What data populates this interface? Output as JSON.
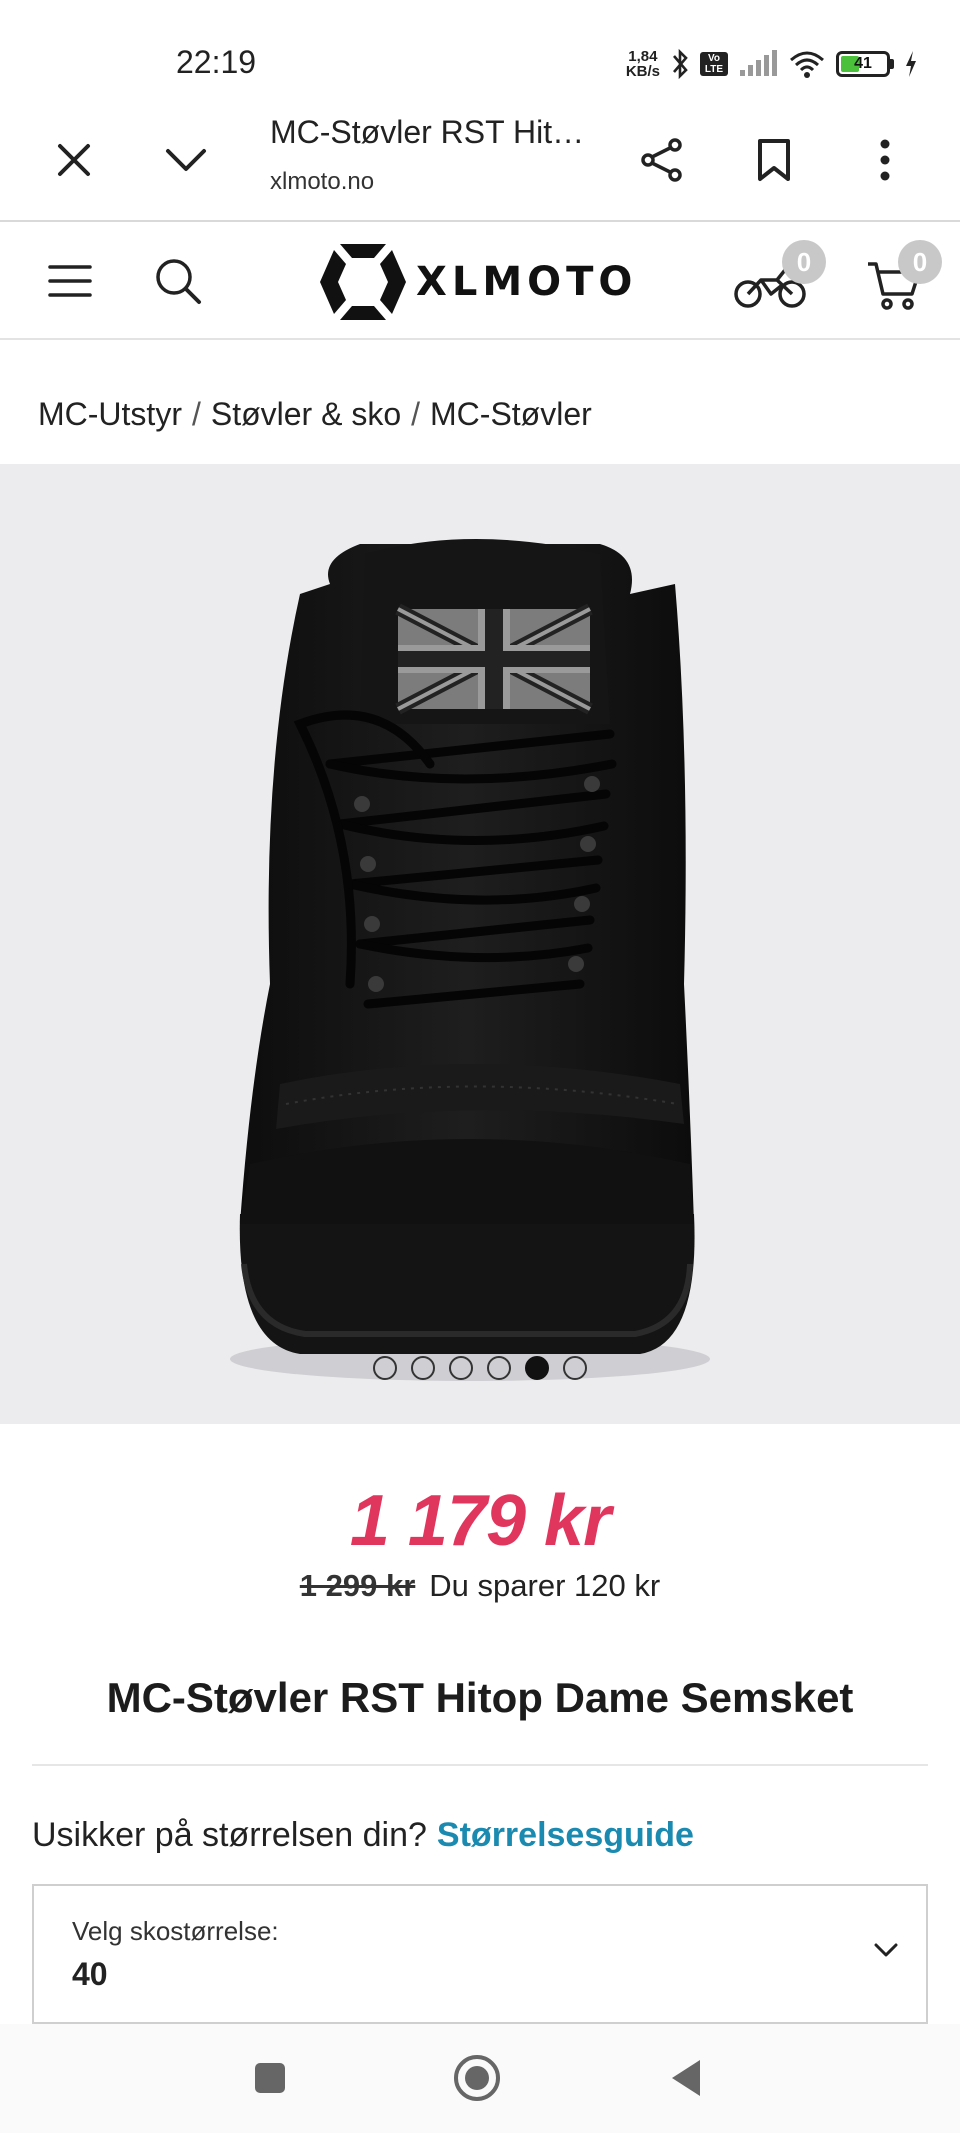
{
  "status_bar": {
    "time": "22:19",
    "net_speed_value": "1,84",
    "net_speed_unit": "KB/s",
    "volte": "Vo LTE",
    "battery_level": "41",
    "battery_fraction": 0.41,
    "battery_color": "#4bc03a"
  },
  "browser": {
    "tab_title": "MC-Støvler RST Hitop Dame Semsket",
    "url": "xlmoto.no",
    "icons": [
      "close-icon",
      "chevron-down-icon",
      "share-icon",
      "bookmark-icon",
      "more-vert-icon"
    ]
  },
  "site_header": {
    "brand": "XLMOTO",
    "garage_count": "0",
    "cart_count": "0",
    "icons": [
      "menu-icon",
      "search-icon",
      "motorcycle-icon",
      "cart-icon"
    ]
  },
  "breadcrumb": {
    "items": [
      "MC-Utstyr",
      "Støvler & sko",
      "MC-Støvler"
    ],
    "separator": "/"
  },
  "gallery": {
    "image_count": 6,
    "active_index": 4
  },
  "product": {
    "price": "1 179 kr",
    "old_price": "1 299 kr",
    "savings": "Du sparer 120 kr",
    "title": "MC-Støvler RST Hitop Dame Semsket",
    "price_color": "#e0365e"
  },
  "size": {
    "question": "Usikker på størrelsen din?",
    "guide_link": "Størrelsesguide",
    "select_label": "Velg skostørrelse:",
    "selected": "40"
  },
  "nav_bar": {
    "icons": [
      "recents-icon",
      "home-icon",
      "back-icon"
    ]
  }
}
